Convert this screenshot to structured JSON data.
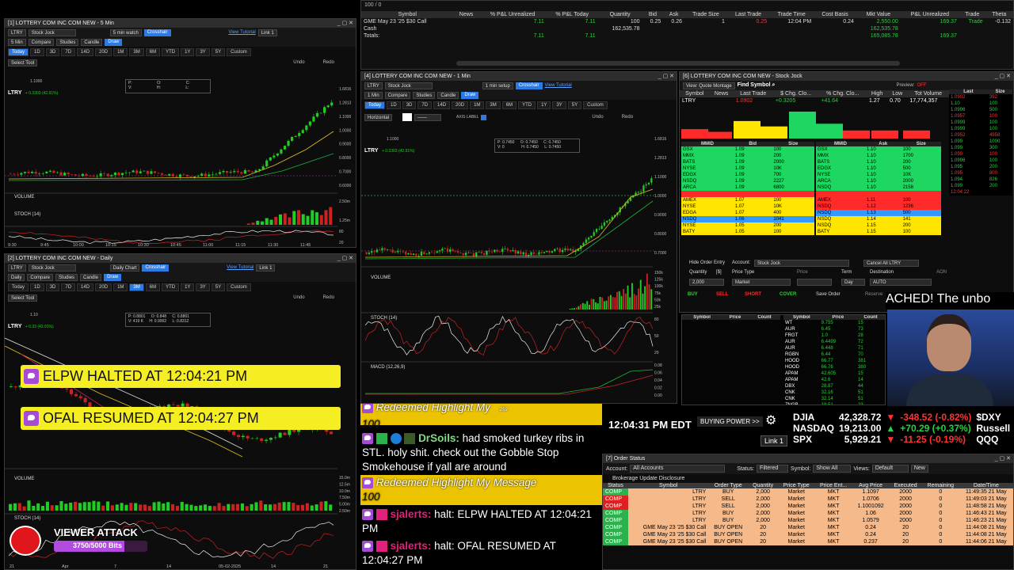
{
  "colors": {
    "up": "#22cc22",
    "down": "#cc2222",
    "accent": "#2c7be5",
    "yellow": "#ffd400",
    "bid": "#1ed760",
    "ask": "#ff2a2a"
  },
  "positions": {
    "header_text": "100 / 0",
    "columns": [
      "Symbol",
      "News",
      "% P&L Unrealized",
      "% P&L Today",
      "Quantity",
      "Bid",
      "Ask",
      "Trade Size",
      "Last Trade",
      "Trade Time",
      "Cost Basis",
      "Mkt Value",
      "P&L Unrealized",
      "Trade",
      "Theta"
    ],
    "rows": [
      {
        "symbol": "GME May 23 '25 $30 Call",
        "news": "",
        "pnl_unrl_pct": "7.11",
        "pnl_today_pct": "7.11",
        "qty": "100",
        "bid": "0.25",
        "ask": "0.26",
        "trade_size": "1",
        "last": "0.25",
        "time": "12:04 PM",
        "cost": "0.24",
        "mkt": "2,550.00",
        "pnl_unrl": "169.37",
        "trade": "Trade",
        "theta": "-0.132"
      },
      {
        "symbol": "Cash",
        "news": "",
        "pnl_unrl_pct": "",
        "pnl_today_pct": "",
        "qty": "162,535.78",
        "bid": "",
        "ask": "",
        "trade_size": "",
        "last": "",
        "time": "",
        "cost": "",
        "mkt": "162,535.78",
        "pnl_unrl": "",
        "trade": "",
        "theta": ""
      },
      {
        "symbol": "Totals:",
        "news": "",
        "pnl_unrl_pct": "7.11",
        "pnl_today_pct": "7.11",
        "qty": "",
        "bid": "",
        "ask": "",
        "trade_size": "",
        "last": "",
        "time": "",
        "cost": "",
        "mkt": "165,085.78",
        "pnl_unrl": "169.37",
        "trade": "",
        "theta": ""
      }
    ]
  },
  "chart1": {
    "title": "[1] LOTTERY COM INC COM NEW - 5 Min",
    "symbol": "LTRY",
    "interval": "5 min watch",
    "layout": "Stock Jock",
    "compare": "Compare",
    "studies": "Studies",
    "candle": "Candle",
    "crosshair": "Crosshair",
    "draw": "Draw",
    "tutorial": "View Tutorial",
    "link": "Link 1",
    "tf": [
      "Today",
      "1D",
      "3D",
      "7D",
      "14D",
      "20D",
      "1M",
      "3M",
      "6M",
      "YTD",
      "1Y",
      "3Y",
      "5Y",
      "Custom"
    ],
    "tool": "Select Tool",
    "undo": "Undo",
    "redo": "Redo",
    "price": "1.1000",
    "change": "+ 0.3303 (42.91%)",
    "ohlc": [
      "P:",
      "O:",
      "C:",
      "V:",
      "H:",
      "L:"
    ],
    "yaxis": [
      "1.6816",
      "1.2813",
      "1.1000",
      "1.0000",
      "0.9000",
      "0.8000",
      "0.7000",
      "0.6000"
    ],
    "volume": "VOLUME",
    "vol_axis": [
      "2.50m",
      "1.25m"
    ],
    "stoch": "STOCH (14)",
    "stoch_axis": [
      "80",
      "20"
    ],
    "xaxis": [
      "9:30",
      "9:45",
      "10:00",
      "10:15",
      "10:30",
      "10:45",
      "11:00",
      "11:15",
      "11:30",
      "11:45"
    ]
  },
  "chart2": {
    "title": "[2] LOTTERY COM INC COM NEW - Daily",
    "symbol": "LTRY",
    "interval": "Daily Chart",
    "layout": "Stock Jock",
    "tutorial": "View Tutorial",
    "link": "Link 1",
    "tool": "Select Tool",
    "price": "1.10",
    "change": "+ 0.33 (42.91%)",
    "ohlc": [
      "P: 0.8801",
      "O: 0.848",
      "C: 0.8801",
      "V: 419 K",
      "H: 0.9002",
      "L: 0.8312"
    ],
    "volume": "VOLUME",
    "vol_axis": [
      "15.0m",
      "12.5m",
      "10.0m",
      "7.50m",
      "5.00m",
      "2.50m"
    ],
    "stoch": "STOCH (14)",
    "xaxis": [
      "21",
      "Apr",
      "7",
      "14",
      "05-02-2025",
      "14",
      "21"
    ]
  },
  "chart4": {
    "title": "[4] LOTTERY COM INC COM NEW - 1 Min",
    "symbol": "LTRY",
    "interval": "1 min setup",
    "layout": "Stock Jock",
    "horizontal": "Horizontal",
    "axis_label": "AXIS LABEL",
    "tutorial": "View Tutorial",
    "price": "1.1000",
    "change": "+ 0.3303 (42.91%)",
    "ohlc": [
      "P: 0.7450",
      "O: 0.7450",
      "C: 0.7450",
      "V: 0",
      "H: 0.7450",
      "L: 0.7450"
    ],
    "yaxis": [
      "1.6816",
      "1.2813",
      "1.1000",
      "1.0000",
      "0.9000",
      "0.8000",
      "0.7000"
    ],
    "volume": "VOLUME",
    "vol_axis": [
      "150k",
      "125k",
      "100k",
      "75k",
      "50k",
      "25k"
    ],
    "stoch": "STOCH (14)",
    "stoch_axis": [
      "80",
      "50",
      "20"
    ],
    "macd": "MACD (12,26,9)",
    "macd_axis": [
      "0.08",
      "0.06",
      "0.04",
      "0.02",
      "0.00"
    ]
  },
  "stockjock": {
    "title": "[6] LOTTERY COM INC COM NEW - Stock Jock",
    "view": "View: Quote Montage",
    "find": "Find Symbol",
    "preview": "Preview:",
    "preview_state": "OFF",
    "quote_cols": [
      "Symbol",
      "News",
      "Last Trade",
      "$ Chg. Clo...",
      "% Chg. Clo...",
      "High",
      "Low",
      "Tot Volume"
    ],
    "quote": [
      "LTRY",
      "",
      "1.0902",
      "+0.3205",
      "+41.64",
      "1.27",
      "0.70",
      "17,774,357"
    ],
    "bid_cols": [
      "MMID",
      "Bid",
      "Size"
    ],
    "ask_cols": [
      "MMID",
      "Ask",
      "Size"
    ],
    "bids": [
      [
        "GSX",
        "1.09",
        "100"
      ],
      [
        "MMX",
        "1.09",
        "200"
      ],
      [
        "BATS",
        "1.09",
        "2000"
      ],
      [
        "NYSE",
        "1.09",
        "10K"
      ],
      [
        "EDGX",
        "1.09",
        "700"
      ],
      [
        "NSDQ",
        "1.09",
        "2227"
      ],
      [
        "ARCA",
        "1.09",
        "6800"
      ],
      [
        "",
        "",
        ""
      ],
      [
        "AMEX",
        "1.07",
        "100"
      ],
      [
        "NYSE",
        "1.07",
        "10K"
      ],
      [
        "EDGA",
        "1.07",
        "400"
      ],
      [
        "NSDQ",
        "1.06",
        "1041"
      ],
      [
        "NYSE",
        "1.05",
        "200"
      ],
      [
        "BATY",
        "1.05",
        "100"
      ]
    ],
    "asks": [
      [
        "GSX",
        "1.10",
        "100"
      ],
      [
        "MMX",
        "1.10",
        "1700"
      ],
      [
        "BATS",
        "1.10",
        "200"
      ],
      [
        "EDGX",
        "1.10",
        "500"
      ],
      [
        "NYSE",
        "1.10",
        "10K"
      ],
      [
        "ARCA",
        "1.10",
        "2000"
      ],
      [
        "NSDQ",
        "1.10",
        "2158"
      ],
      [
        "",
        "",
        ""
      ],
      [
        "AMEX",
        "1.11",
        "100"
      ],
      [
        "NSDQ",
        "1.12",
        "1236"
      ],
      [
        "NSDQ",
        "1.13",
        "500"
      ],
      [
        "NSDQ",
        "1.14",
        "141"
      ],
      [
        "NSDQ",
        "1.15",
        "200"
      ],
      [
        "BATY",
        "1.15",
        "100"
      ]
    ],
    "tape_cols": [
      "Last",
      "Size"
    ],
    "tape": [
      [
        "1.0902",
        "392"
      ],
      [
        "1.10",
        "100"
      ],
      [
        "1.0996",
        "500"
      ],
      [
        "1.0957",
        "100"
      ],
      [
        "1.0999",
        "100"
      ],
      [
        "1.0999",
        "100"
      ],
      [
        "1.0952",
        "4958"
      ],
      [
        "1.099",
        "1000"
      ],
      [
        "1.099",
        "300"
      ],
      [
        "1.099",
        "100"
      ],
      [
        "1.0996",
        "100"
      ],
      [
        "1.095",
        "200"
      ],
      [
        "1.095",
        "800"
      ],
      [
        "1.094",
        "826"
      ],
      [
        "1.099",
        "200"
      ],
      [
        "12:04:22",
        ""
      ]
    ],
    "order": {
      "hide": "Hide Order Entry",
      "account_lbl": "Account:",
      "account": "Stock Jock",
      "cancel": "Cancel All LTRY",
      "qty_lbl": "Quantity",
      "qty_unit": "[$]",
      "qty": "2,000",
      "ptype_lbl": "Price Type",
      "ptype": "Market",
      "price_lbl": "Price",
      "term_lbl": "Term",
      "term": "Day",
      "dest_lbl": "Destination",
      "dest": "AUTO",
      "aon": "AON",
      "buy": "BUY",
      "sell": "SELL",
      "short": "SHORT",
      "cover": "COVER",
      "save": "Save Order",
      "reserve": "Reserve"
    }
  },
  "scanner": {
    "cols_left": [
      "Symbol",
      "Price",
      "Count"
    ],
    "cols_right": [
      "Symbol",
      "Price",
      "Count"
    ],
    "right_rows": [
      [
        "WT",
        "9.755",
        "15"
      ],
      [
        "AUR",
        "6.45",
        "73"
      ],
      [
        "FRGT",
        "1.0",
        "28"
      ],
      [
        "AUR",
        "6.4499",
        "72"
      ],
      [
        "AUR",
        "6.448",
        "71"
      ],
      [
        "RGBN",
        "6.44",
        "70"
      ],
      [
        "HOOD",
        "66.77",
        "381"
      ],
      [
        "HOOD",
        "66.76",
        "380"
      ],
      [
        "APAM",
        "42.605",
        "15"
      ],
      [
        "APAM",
        "42.6",
        "14"
      ],
      [
        "DBX",
        "28.87",
        "44"
      ],
      [
        "CNK",
        "32.16",
        "51"
      ],
      [
        "CNK",
        "32.14",
        "51"
      ],
      [
        "ZNGB",
        "19.51",
        "23"
      ]
    ]
  },
  "stream": {
    "ticker_text": "ACHED!  The unbo",
    "clock": "12:04:31 PM EDT",
    "buying_power": "BUYING POWER >>",
    "link": "Link 1"
  },
  "indices": [
    {
      "name": "DJIA",
      "value": "42,328.72",
      "dir": "down",
      "chg": "-348.52 (-0.82%)",
      "sym": "$DXY"
    },
    {
      "name": "NASDAQ",
      "value": "19,213.00",
      "dir": "up",
      "chg": "+70.29 (+0.37%)",
      "sym": "Russell"
    },
    {
      "name": "SPX",
      "value": "5,929.21",
      "dir": "down",
      "chg": "-11.25 (-0.19%)",
      "sym": "QQQ"
    }
  ],
  "alerts": [
    {
      "text": "ELPW HALTED AT 12:04:21 PM"
    },
    {
      "text": "OFAL RESUMED AT 12:04:27 PM"
    }
  ],
  "chat": {
    "top_badges": "259",
    "m1": {
      "highlight": "Redeemed Highlight My",
      "cont": "100"
    },
    "m2": {
      "user": "DrSoils:",
      "text": "had smoked turkey ribs in STL. holy shit. check out the Gobble Stop Smokehouse if yall are around"
    },
    "m3": {
      "highlight": "Redeemed Highlight My Message",
      "cont": "100"
    },
    "m4": {
      "user": "sjalerts:",
      "text": "halt: ELPW HALTED AT 12:04:21 PM"
    },
    "m5": {
      "user": "sjalerts:",
      "text": "halt: OFAL RESUMED AT 12:04:27 PM"
    }
  },
  "viewer_attack": {
    "title": "VIEWER ATTACK",
    "bits": "3750/5000 Bits",
    "progress": 0.75
  },
  "orders": {
    "title": "[7] Order Status",
    "account_lbl": "Account:",
    "account": "All Accounts",
    "status_lbl": "Status:",
    "status": "Filtered",
    "symbol_lbl": "Symbol:",
    "symbol": "Show All",
    "views_lbl": "Views:",
    "views": "Default",
    "new": "New",
    "disclosure": "Brokerage Update Disclosure",
    "cols": [
      "Status",
      "Symbol",
      "Order Type",
      "Quantity",
      "Price Type",
      "Price Ent...",
      "Avg Price",
      "Executed",
      "Remaining",
      "Date/Time"
    ],
    "rows": [
      [
        "COMP",
        "LTRY",
        "BUY",
        "2,000",
        "Market",
        "MKT",
        "1.1097",
        "2000",
        "0",
        "11:49:35 21 May"
      ],
      [
        "COMP",
        "LTRY",
        "SELL",
        "2,000",
        "Market",
        "MKT",
        "1.0706",
        "2000",
        "0",
        "11:49:03 21 May"
      ],
      [
        "COMP",
        "LTRY",
        "SELL",
        "2,000",
        "Market",
        "MKT",
        "1.1001092",
        "2000",
        "0",
        "11:48:58 21 May"
      ],
      [
        "COMP",
        "LTRY",
        "BUY",
        "2,000",
        "Market",
        "MKT",
        "1.06",
        "2000",
        "0",
        "11:46:43 21 May"
      ],
      [
        "COMP",
        "LTRY",
        "BUY",
        "2,000",
        "Market",
        "MKT",
        "1.0579",
        "2000",
        "0",
        "11:46:23 21 May"
      ],
      [
        "COMP",
        "GME May 23 '25 $30 Call",
        "BUY OPEN",
        "20",
        "Market",
        "MKT",
        "0.24",
        "20",
        "0",
        "11:44:08 21 May"
      ],
      [
        "COMP",
        "GME May 23 '25 $30 Call",
        "BUY OPEN",
        "20",
        "Market",
        "MKT",
        "0.24",
        "20",
        "0",
        "11:44:08 21 May"
      ],
      [
        "COMP",
        "GME May 23 '25 $30 Call",
        "BUY OPEN",
        "20",
        "Market",
        "MKT",
        "0.237",
        "20",
        "0",
        "11:44:06 21 May"
      ]
    ]
  }
}
